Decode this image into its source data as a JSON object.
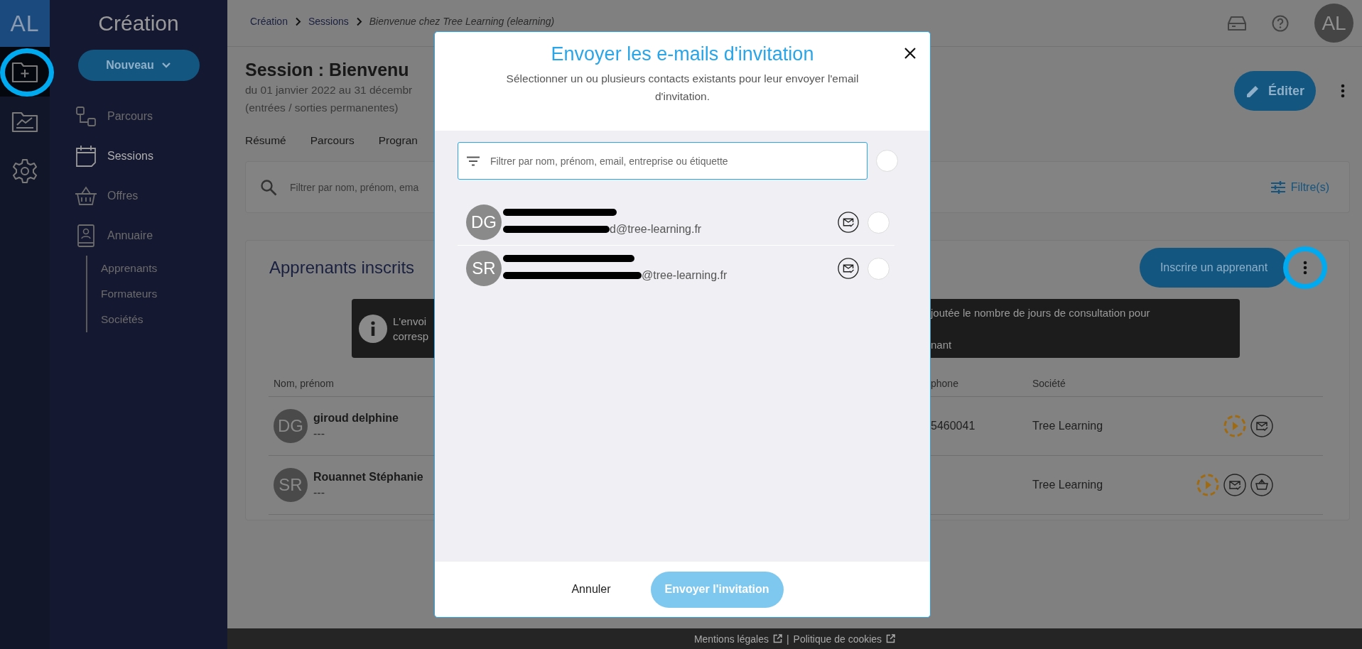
{
  "rail": {
    "logo": "AL",
    "items": [
      {
        "kind": "folder",
        "selected": true,
        "highlighted": true
      },
      {
        "kind": "chart",
        "selected": false,
        "highlighted": false
      },
      {
        "kind": "gear",
        "selected": false,
        "highlighted": false
      }
    ]
  },
  "sidebar": {
    "title": "Création",
    "new_button": "Nouveau",
    "items": [
      {
        "kind": "path",
        "label": "Parcours",
        "selected": false
      },
      {
        "kind": "calendar",
        "label": "Sessions",
        "selected": true
      },
      {
        "kind": "basket",
        "label": "Offres",
        "selected": false
      },
      {
        "kind": "contact",
        "label": "Annuaire",
        "selected": false,
        "children": [
          {
            "label": "Apprenants",
            "selected": false
          },
          {
            "label": "Formateurs",
            "selected": false
          },
          {
            "label": "Sociétés",
            "selected": false
          }
        ]
      }
    ]
  },
  "breadcrumb": [
    "Création",
    "Sessions",
    "Bienvenue chez Tree Learning (elearning)"
  ],
  "user_avatar": "AL",
  "session": {
    "title": "Session : Bienvenu",
    "dates": "du 01 janvier 2022 au 31 décembr",
    "note": "(entrées / sorties permanentes)",
    "edit_button": "Éditer"
  },
  "tabs": [
    "Résumé",
    "Parcours",
    "Progran"
  ],
  "search": {
    "placeholder": "Filtrer par nom, prénom, ema",
    "filter_button": "Filtre(s)"
  },
  "learners": {
    "title": "Apprenants inscrits",
    "enroll_button": "Inscrire un apprenant",
    "menu_highlighted": true,
    "notice": {
      "left_lines": [
        "L'envoi",
        "corresp"
      ],
      "right_lines": [
        "joutée le nombre de jours de consultation pour",
        "nant"
      ]
    },
    "columns": [
      "Nom, prénom",
      "phone",
      "Société"
    ],
    "rows": [
      {
        "initials": "DG",
        "name": "giroud delphine",
        "detail": "---",
        "phone": "5460041",
        "company": "Tree Learning",
        "actions": [
          {
            "kind": "play"
          },
          {
            "kind": "mail"
          }
        ]
      },
      {
        "initials": "SR",
        "name": "Rouannet Stéphanie",
        "detail": "---",
        "company": "Tree Learning",
        "actions": [
          {
            "kind": "play"
          },
          {
            "kind": "mail"
          },
          {
            "kind": "basket"
          }
        ]
      }
    ]
  },
  "modal": {
    "title": "Envoyer les e-mails d'invitation",
    "subtitle": "Sélectionner un ou plusieurs contacts existants pour leur envoyer l'email d'invitation.",
    "filter_placeholder": "Filtrer par nom, prénom, email, entreprise ou étiquette",
    "select_all": {
      "selected": false
    },
    "contacts": [
      {
        "initials": "DG",
        "email": "d@tree-learning.fr",
        "selected": false
      },
      {
        "initials": "SR",
        "email": "@tree-learning.fr",
        "selected": false
      }
    ],
    "cancel": "Annuler",
    "send": {
      "label": "Envoyer l'invitation",
      "disabled": true
    }
  },
  "footer": {
    "links": [
      "Mentions légales",
      "Politique de cookies"
    ],
    "separator": "|"
  }
}
